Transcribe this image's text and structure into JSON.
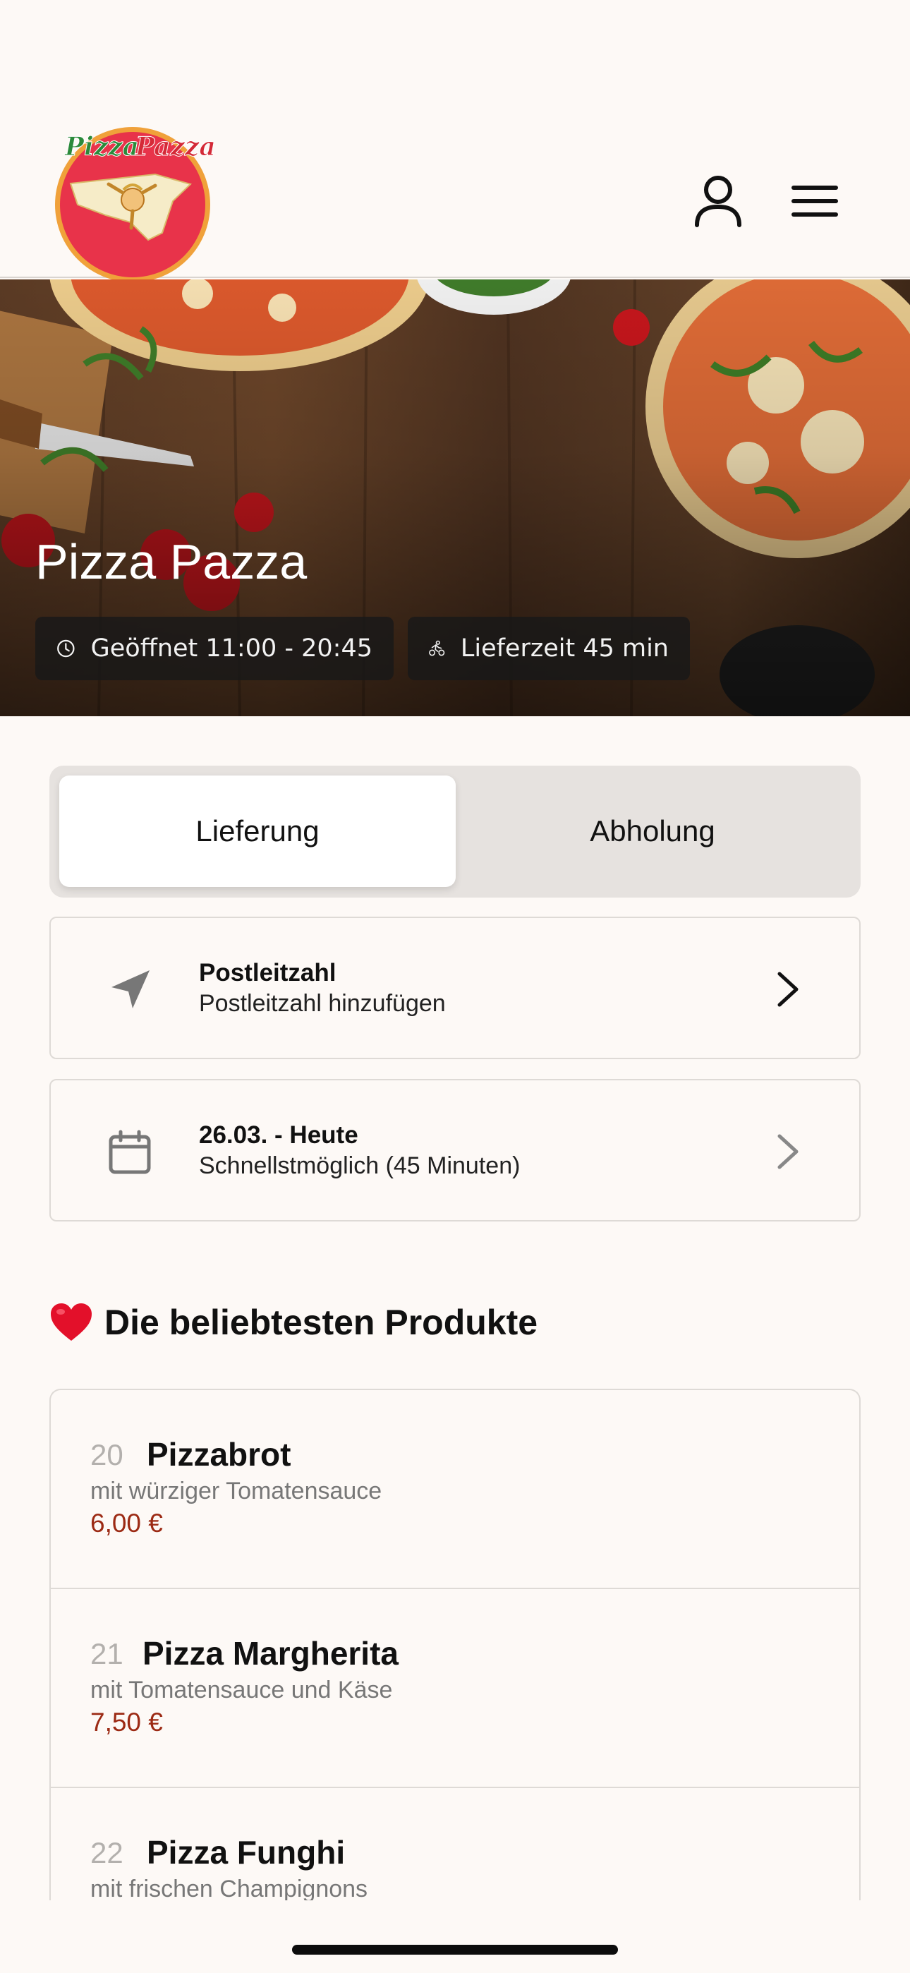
{
  "header": {
    "logo_text": "Pizza Pazza",
    "profile_icon": "person-icon",
    "menu_icon": "hamburger-menu-icon"
  },
  "hero": {
    "title": "Pizza Pazza",
    "opening_hours": "Geöffnet 11:00 - 20:45",
    "delivery_time": "Lieferzeit 45 min",
    "opening_icon": "clock-icon",
    "delivery_icon": "bike-courier-icon"
  },
  "order_mode": {
    "options": [
      "Lieferung",
      "Abholung"
    ],
    "selected": "Lieferung"
  },
  "postal_card": {
    "icon": "location-arrow-icon",
    "title": "Postleitzahl",
    "subtitle": "Postleitzahl hinzufügen"
  },
  "date_card": {
    "icon": "calendar-icon",
    "title": "26.03. - Heute",
    "subtitle": "Schnellstmöglich (45 Minuten)"
  },
  "popular": {
    "heading": "Die beliebtesten Produkte",
    "heading_icon": "red-heart-icon",
    "products": [
      {
        "number": "20",
        "name": "Pizzabrot",
        "description": "mit würziger Tomatensauce",
        "price": "6,00 €"
      },
      {
        "number": "21",
        "name": "Pizza Margherita",
        "description": "mit Tomatensauce und Käse",
        "price": "7,50 €"
      },
      {
        "number": "22",
        "name": "Pizza Funghi",
        "description": "mit frischen Champignons",
        "price": ""
      }
    ]
  },
  "colors": {
    "background": "#fdf9f6",
    "price": "#9c2a14",
    "logo_red": "#e8334a",
    "toggle_bg": "#e6e2df"
  }
}
